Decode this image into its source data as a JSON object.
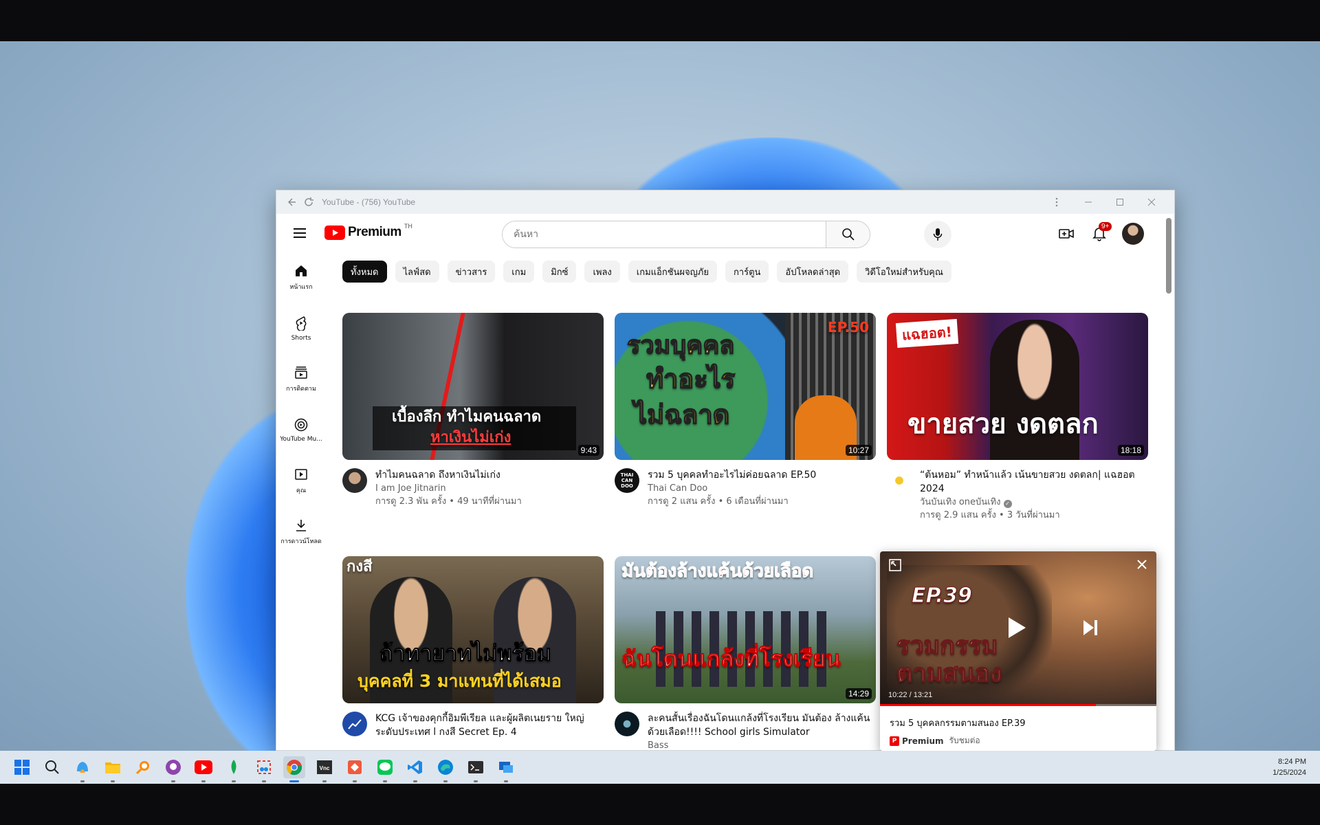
{
  "window": {
    "title": "YouTube - (756) YouTube"
  },
  "header": {
    "logo_text": "Premium",
    "country_code": "TH",
    "search_placeholder": "ค้นหา",
    "notification_badge": "9+"
  },
  "sidebar": {
    "items": [
      {
        "label": "หน้าแรก",
        "icon": "home-icon"
      },
      {
        "label": "Shorts",
        "icon": "shorts-icon"
      },
      {
        "label": "การติดตาม",
        "icon": "subscriptions-icon"
      },
      {
        "label": "YouTube Mu...",
        "icon": "youtube-music-icon"
      },
      {
        "label": "คุณ",
        "icon": "you-icon"
      },
      {
        "label": "การดาวน์โหลด",
        "icon": "download-icon"
      }
    ]
  },
  "chips": [
    "ทั้งหมด",
    "ไลฟ์สด",
    "ข่าวสาร",
    "เกม",
    "มิกซ์",
    "เพลง",
    "เกมแอ็กชันผจญภัย",
    "การ์ตูน",
    "อัปโหลดล่าสุด",
    "วิดีโอใหม่สำหรับคุณ"
  ],
  "videos": [
    {
      "title": "ทำไมคนฉลาด ถึงหาเงินไม่เก่ง",
      "channel": "I am Joe Jitnarin",
      "stats": "การดู 2.3 พัน ครั้ง • 49 นาทีที่ผ่านมา",
      "duration": "9:43",
      "thumb_line1": "เบื้องลึก ทำไมคนฉลาด",
      "thumb_line2": "หาเงินไม่เก่ง"
    },
    {
      "title": "รวม 5 บุคคลทำอะไรไม่ค่อยฉลาด EP.50",
      "channel": "Thai Can Doo",
      "stats": "การดู 2 แสน ครั้ง • 6 เดือนที่ผ่านมา",
      "duration": "10:27",
      "thumb_line1": "รวมบุคคล",
      "thumb_line2": "ทำอะไร",
      "thumb_line3": "ไม่ฉลาด",
      "thumb_ep": "EP.50",
      "channel_badge": "THAI CAN DOO"
    },
    {
      "title": "“ต้นหอม” ทำหน้าแล้ว เน้นขายสวย งดตลก| แฉฮอต 2024",
      "channel": "วันบันเทิง oneบันเทิง",
      "stats": "การดู 2.9 แสน ครั้ง • 3 วันที่ผ่านมา",
      "duration": "18:18",
      "thumb_tag": "แฉฮอต!",
      "thumb_line1": "ขายสวย งดตลก",
      "verified": true
    },
    {
      "title": "KCG เจ้าของคุกกี้อิมพีเรียล และผู้ผลิตเนยราย ใหญ่ ระดับประเทศ l กงสี Secret Ep. 4",
      "channel": "",
      "stats": "",
      "duration": "",
      "thumb_brand": "กงสี",
      "thumb_line1": "ถ้าทายาทไม่พร้อม",
      "thumb_line2": "บุคคลที่ 3 มาแทนที่ได้เสมอ"
    },
    {
      "title": "ละคนสั้นเรื่องฉันโดนแกล้งที่โรงเรียน มันต้อง ล้างแค้นด้วยเลือด!!!! School girls Simulator",
      "channel": "Bass",
      "stats": "",
      "duration": "14:29",
      "thumb_line1": "มันต้องล้างแค้นด้วยเลือด",
      "thumb_line2": "ฉันโดนแกล้งที่โรงเรียน"
    }
  ],
  "miniplayer": {
    "title": "รวม 5 บุคคลกรรมตามสนอง EP.39",
    "badge": "Premium",
    "status": "รับชมต่อ",
    "time": "10:22 / 13:21",
    "progress": 0.78,
    "thumb_ep": "EP.39",
    "thumb_line1": "รวมกรรม",
    "thumb_line2": "ตามสนอง"
  },
  "taskbar": {
    "time": "8:24 PM",
    "date": "1/25/2024"
  }
}
